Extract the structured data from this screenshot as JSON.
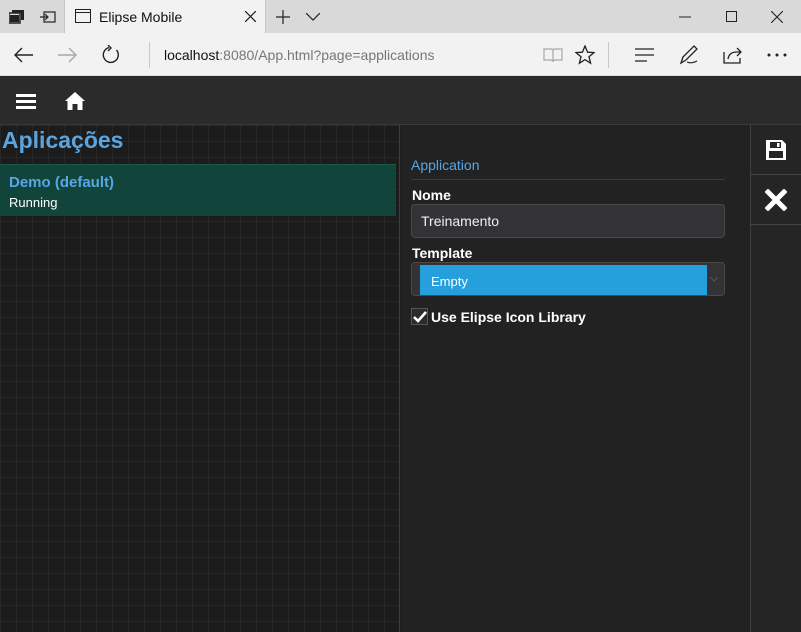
{
  "browser": {
    "tab_title": "Elipse Mobile",
    "url_host": "localhost",
    "url_rest": ":8080/App.html?page=applications"
  },
  "page": {
    "title": "Aplicações"
  },
  "applications": [
    {
      "name": "Demo (default)",
      "status": "Running"
    }
  ],
  "form": {
    "section_title": "Application",
    "name_label": "Nome",
    "name_value": "Treinamento",
    "template_label": "Template",
    "template_value": "Empty",
    "icon_library_label": "Use Elipse Icon Library",
    "icon_library_checked": true
  },
  "colors": {
    "accent": "#5aa5e0",
    "selected_item_bg": "#11443a",
    "select_highlight": "#26a0dc"
  },
  "icons": [
    "tab-manager-icon",
    "set-aside-tabs-icon",
    "page-icon",
    "close-icon",
    "plus-icon",
    "chevron-down-icon",
    "minimize-icon",
    "maximize-icon",
    "back-icon",
    "forward-icon",
    "refresh-icon",
    "reading-view-icon",
    "favorite-star-icon",
    "hub-icon",
    "pen-icon",
    "share-icon",
    "more-icon",
    "hamburger-menu-icon",
    "home-icon",
    "save-icon",
    "cancel-x-icon",
    "checkmark-icon"
  ]
}
